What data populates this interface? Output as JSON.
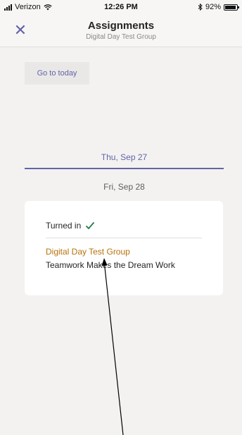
{
  "status_bar": {
    "carrier": "Verizon",
    "time": "12:26 PM",
    "battery": "92%",
    "battery_level": 0.92
  },
  "header": {
    "title": "Assignments",
    "subtitle": "Digital Day Test Group",
    "close_icon": "close-icon"
  },
  "toolbar": {
    "today_label": "Go to today"
  },
  "dates": {
    "selected": "Thu, Sep 27",
    "next": "Fri, Sep 28"
  },
  "assignment": {
    "status": "Turned in",
    "class_name": "Digital Day Test Group",
    "title": "Teamwork Makes the Dream Work"
  },
  "colors": {
    "accent": "#6264a7",
    "class_name": "#b7720c",
    "check": "#237b4b"
  }
}
